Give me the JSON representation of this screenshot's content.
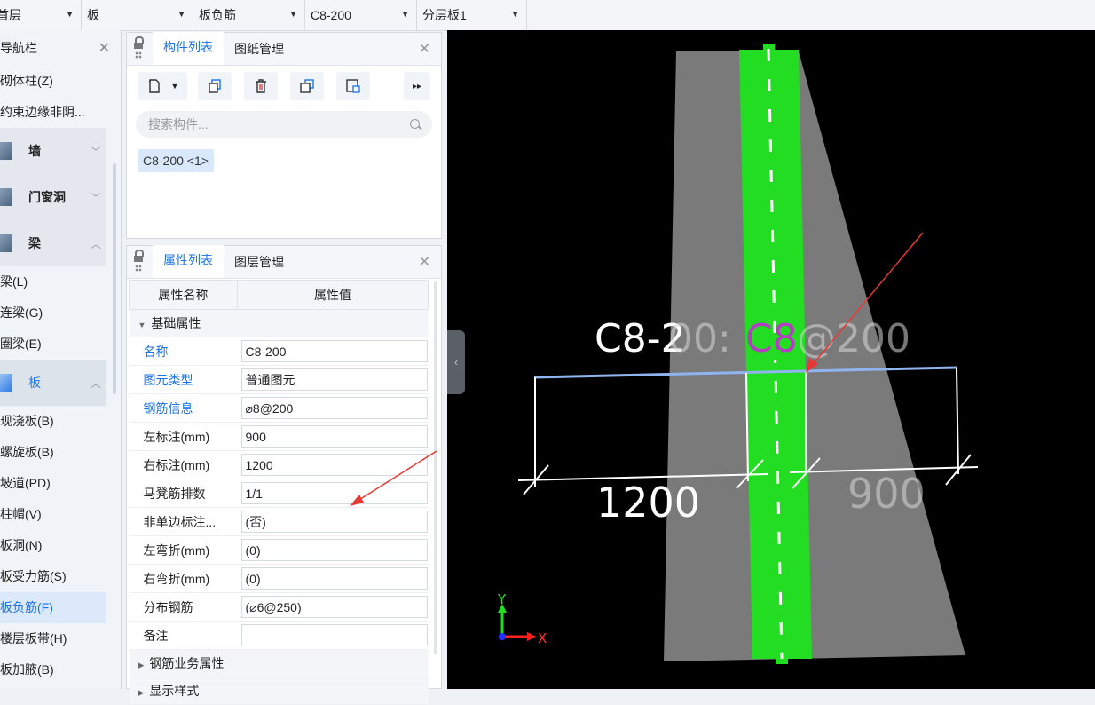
{
  "toolbar": {
    "combos": [
      {
        "value": "首层"
      },
      {
        "value": "板"
      },
      {
        "value": "板负筋"
      },
      {
        "value": "C8-200"
      },
      {
        "value": "分层板1"
      }
    ]
  },
  "nav": {
    "title": "导航栏",
    "items": [
      {
        "type": "item",
        "label": "砌体柱(Z)"
      },
      {
        "type": "item",
        "label": "约束边缘非阴..."
      },
      {
        "type": "group",
        "label": "墙",
        "expanded": false
      },
      {
        "type": "group",
        "label": "门窗洞",
        "expanded": false
      },
      {
        "type": "group",
        "label": "梁",
        "expanded": true
      },
      {
        "type": "item",
        "label": "梁(L)"
      },
      {
        "type": "item",
        "label": "连梁(G)"
      },
      {
        "type": "item",
        "label": "圈梁(E)"
      },
      {
        "type": "group",
        "label": "板",
        "expanded": true,
        "active": true
      },
      {
        "type": "item",
        "label": "现浇板(B)"
      },
      {
        "type": "item",
        "label": "螺旋板(B)"
      },
      {
        "type": "item",
        "label": "坡道(PD)"
      },
      {
        "type": "item",
        "label": "柱帽(V)"
      },
      {
        "type": "item",
        "label": "板洞(N)"
      },
      {
        "type": "item",
        "label": "板受力筋(S)"
      },
      {
        "type": "item",
        "label": "板负筋(F)",
        "selected": true
      },
      {
        "type": "item",
        "label": "楼层板带(H)"
      },
      {
        "type": "item",
        "label": "板加腋(B)"
      }
    ]
  },
  "component_panel": {
    "tabs": [
      "构件列表",
      "图纸管理"
    ],
    "active_tab": "构件列表",
    "search_placeholder": "搜索构件...",
    "items": [
      "C8-200 <1>"
    ]
  },
  "property_panel": {
    "tabs": [
      "属性列表",
      "图层管理"
    ],
    "active_tab": "属性列表",
    "columns": [
      "属性名称",
      "属性值"
    ],
    "section_basic": "基础属性",
    "rows": [
      {
        "name": "名称",
        "value": "C8-200",
        "blue": true
      },
      {
        "name": "图元类型",
        "value": "普通图元",
        "blue": true
      },
      {
        "name": "钢筋信息",
        "value": "⌀8@200",
        "blue": true
      },
      {
        "name": "左标注(mm)",
        "value": "900",
        "blue": false
      },
      {
        "name": "右标注(mm)",
        "value": "1200",
        "blue": false
      },
      {
        "name": "马凳筋排数",
        "value": "1/1",
        "blue": false
      },
      {
        "name": "非单边标注...",
        "value": "(否)",
        "blue": false
      },
      {
        "name": "左弯折(mm)",
        "value": "(0)",
        "blue": false
      },
      {
        "name": "右弯折(mm)",
        "value": "(0)",
        "blue": false
      },
      {
        "name": "分布钢筋",
        "value": "(⌀6@250)",
        "blue": false
      },
      {
        "name": "备注",
        "value": "",
        "blue": false
      }
    ],
    "section_rebar": "钢筋业务属性",
    "section_display": "显示样式"
  },
  "canvas": {
    "label_prefix": "C8-2",
    "label_mid": "00:",
    "label_magenta": "C8",
    "label_suffix": "@200",
    "dim_left": "1200",
    "dim_right": "900",
    "axis_y": "Y",
    "axis_x": "X",
    "colors": {
      "slab": "#7a7a7a",
      "rebar": "#22dd22",
      "magenta": "#b23fbf",
      "arrow": "#e53935",
      "bar": "#8fb4f0"
    }
  }
}
